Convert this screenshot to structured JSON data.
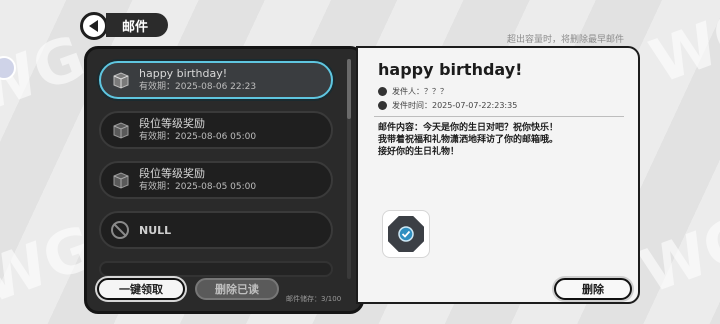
{
  "header": {
    "title": "邮件",
    "capacity_note": "超出容量时，将删除最早邮件"
  },
  "mail_list": {
    "items": [
      {
        "title": "happy birthday!",
        "date": "有效期：2025-08-06 22:23",
        "selected": true,
        "icon": "gift-box-icon"
      },
      {
        "title": "段位等级奖励",
        "date": "有效期：2025-08-06 05:00",
        "selected": false,
        "icon": "gift-box-icon"
      },
      {
        "title": "段位等级奖励",
        "date": "有效期：2025-08-05 05:00",
        "selected": false,
        "icon": "gift-box-icon"
      },
      {
        "title": "NULL",
        "date": "",
        "selected": false,
        "icon": "null-icon"
      }
    ],
    "claim_all_label": "一键领取",
    "delete_read_label": "删除已读",
    "storage_text": "邮件储存：3/100"
  },
  "detail": {
    "title": "happy birthday!",
    "sender": "发件人：？？？",
    "send_time": "发件时间：2025-07-07-22:23:35",
    "content_lines": [
      "邮件内容：今天是你的生日对吧？祝你快乐！",
      "我带着祝福和礼物潇洒地拜访了你的邮箱哦。",
      "接好你的生日礼物！"
    ],
    "delete_label": "删除"
  },
  "colors": {
    "accent": "#5fc6e0",
    "panel_dark": "#2a2a2a",
    "panel_light": "#f4f4f4"
  }
}
